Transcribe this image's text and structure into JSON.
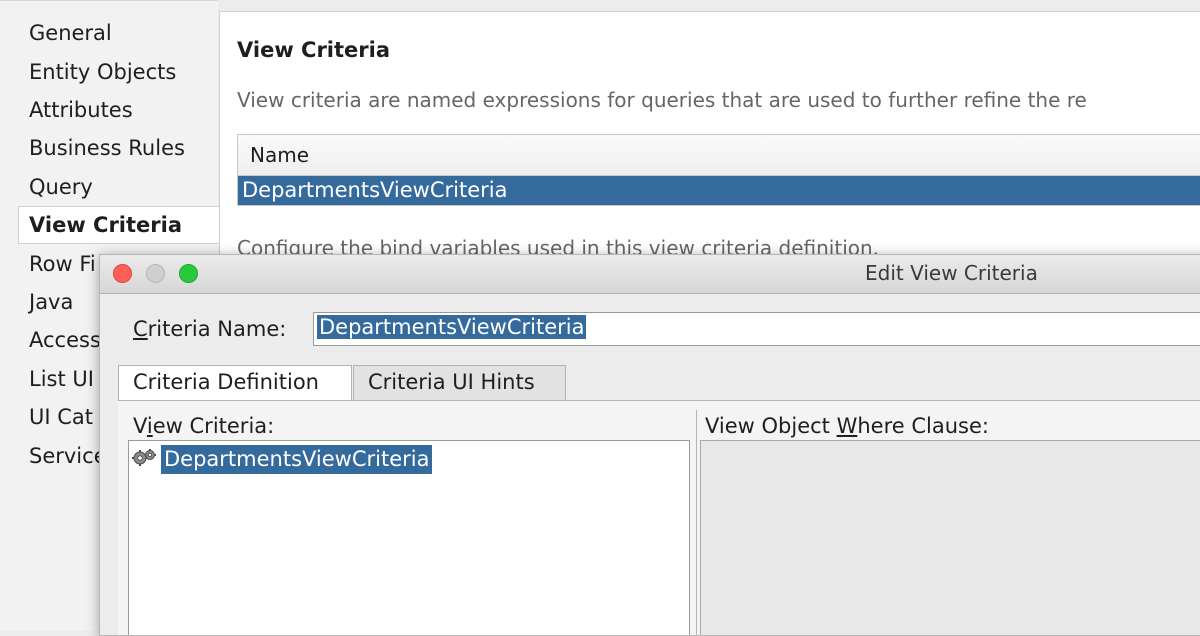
{
  "sidebar": {
    "items": [
      {
        "label": "General"
      },
      {
        "label": "Entity Objects"
      },
      {
        "label": "Attributes"
      },
      {
        "label": "Business Rules"
      },
      {
        "label": "Query"
      },
      {
        "label": "View Criteria",
        "selected": true
      },
      {
        "label": "Row Fi"
      },
      {
        "label": "Java"
      },
      {
        "label": "Access"
      },
      {
        "label": "List UI"
      },
      {
        "label": "UI Cat"
      },
      {
        "label": "Service"
      }
    ]
  },
  "panel": {
    "title": "View Criteria",
    "description": "View criteria are named expressions for queries that are used to further refine the re",
    "table": {
      "header": "Name",
      "rows": [
        "DepartmentsViewCriteria"
      ]
    },
    "config_text": "Configure the bind variables used in this view criteria definition."
  },
  "dialog": {
    "title": "Edit View Criteria",
    "criteria_name_label_rest": "riteria Name:",
    "criteria_name_label_mnemonic": "C",
    "criteria_name_value": "DepartmentsViewCriteria",
    "tabs": [
      {
        "label": "Criteria Definition",
        "active": true
      },
      {
        "label": "Criteria UI Hints",
        "active": false
      }
    ],
    "view_criteria_label_pre": "V",
    "view_criteria_label_mnemonic": "i",
    "view_criteria_label_post": "ew Criteria:",
    "view_criteria_items": [
      "DepartmentsViewCriteria"
    ],
    "where_label_pre": "View Object ",
    "where_label_mnemonic": "W",
    "where_label_post": "here Clause:"
  },
  "colors": {
    "selection": "#356a9c",
    "close": "#ff5f57",
    "minimize_disabled": "#cfcfcf",
    "maximize": "#28c840"
  },
  "icons": {
    "view_criteria_item": "criteria-gears-icon"
  }
}
